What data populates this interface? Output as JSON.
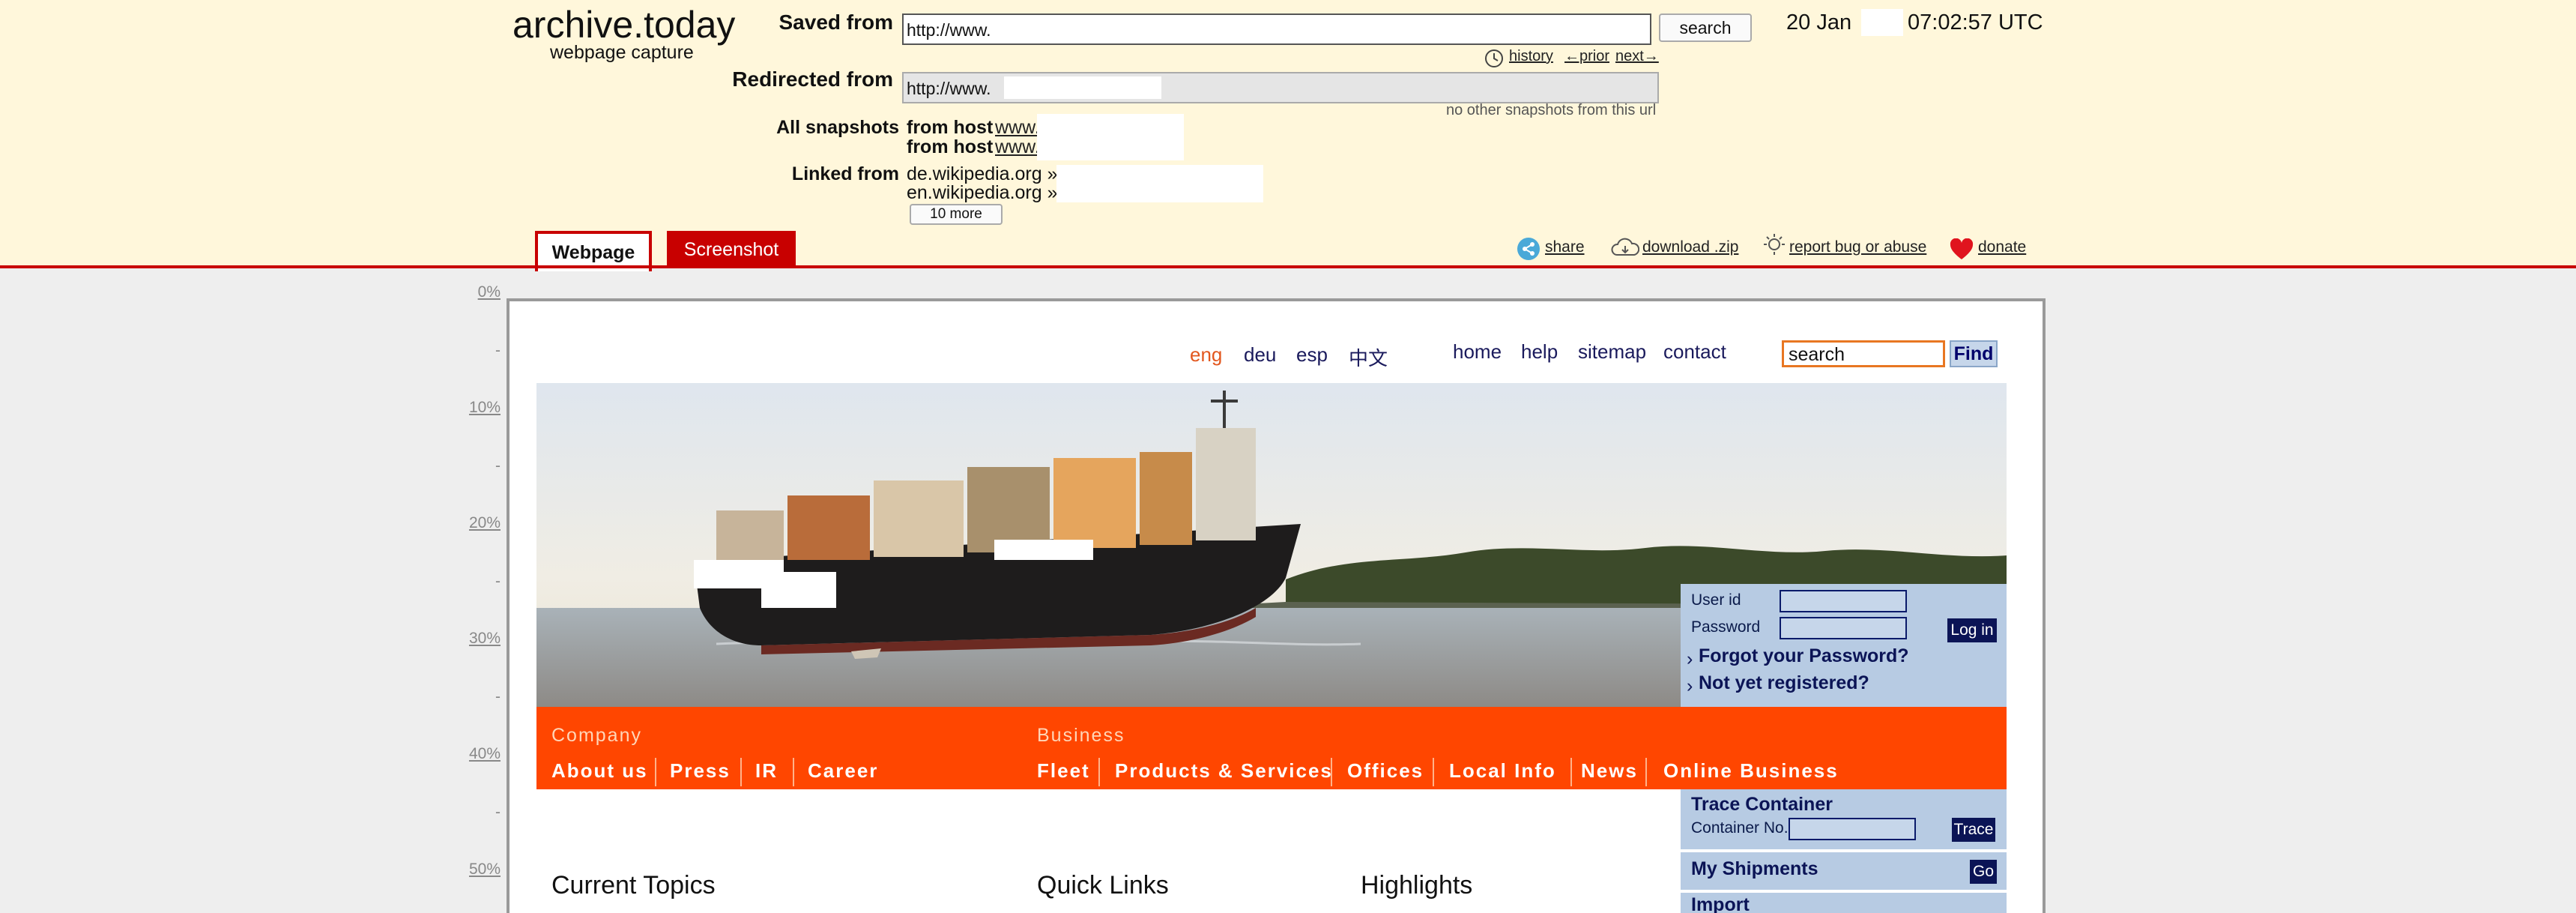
{
  "header": {
    "brand": "archive.today",
    "brand_sub": "webpage capture",
    "saved_from_label": "Saved from",
    "saved_from_value": "http://www.",
    "search_button": "search",
    "date_day": "20 Jan",
    "time": "07:02:57 UTC",
    "history_link": "history",
    "prior_link": "←prior",
    "next_link": "next→",
    "redirected_label": "Redirected from",
    "redirected_value": "http://www.",
    "no_other": "no other snapshots from this url",
    "all_snapshots_label": "All snapshots",
    "from_host_1": "from host",
    "host_1": "www.",
    "from_host_2": "from host",
    "host_2": "www.",
    "linked_from_label": "Linked from",
    "linked_1": "de.wikipedia.org »",
    "linked_2": "en.wikipedia.org »",
    "more_button": "10 more"
  },
  "tabs": {
    "webpage": "Webpage",
    "screenshot": "Screenshot"
  },
  "actions": {
    "share": "share",
    "download": "download .zip",
    "report": "report bug or abuse",
    "donate": "donate"
  },
  "ruler": {
    "p0": "0%",
    "p10": "10%",
    "p20": "20%",
    "p30": "30%",
    "p40": "40%",
    "p50": "50%",
    "dash": "-"
  },
  "site": {
    "languages": [
      "eng",
      "deu",
      "esp",
      "中文"
    ],
    "top_nav": [
      "home",
      "help",
      "sitemap",
      "contact"
    ],
    "search_value": "search",
    "find_button": "Find",
    "login": {
      "user_label": "User id",
      "password_label": "Password",
      "login_button": "Log in",
      "forgot": "Forgot your Password?",
      "register": "Not yet registered?"
    },
    "nav": {
      "company_heading": "Company",
      "business_heading": "Business",
      "company_items": [
        "About us",
        "Press",
        "IR",
        "Career"
      ],
      "business_items": [
        "Fleet",
        "Products & Services",
        "Offices",
        "Local Info",
        "News",
        "Online Business"
      ]
    },
    "panel": {
      "trace_heading": "Trace Container",
      "container_label": "Container No.",
      "trace_button": "Trace",
      "shipments": "My Shipments",
      "go_button": "Go",
      "import": "Import"
    },
    "sections": {
      "current": "Current Topics",
      "quick": "Quick Links",
      "highlights": "Highlights"
    }
  },
  "colors": {
    "header_bg": "#fff7db",
    "accent_red": "#c80000",
    "site_orange": "#ff4600",
    "site_navy": "#0b1456",
    "panel_blue": "#b7cbe3"
  }
}
